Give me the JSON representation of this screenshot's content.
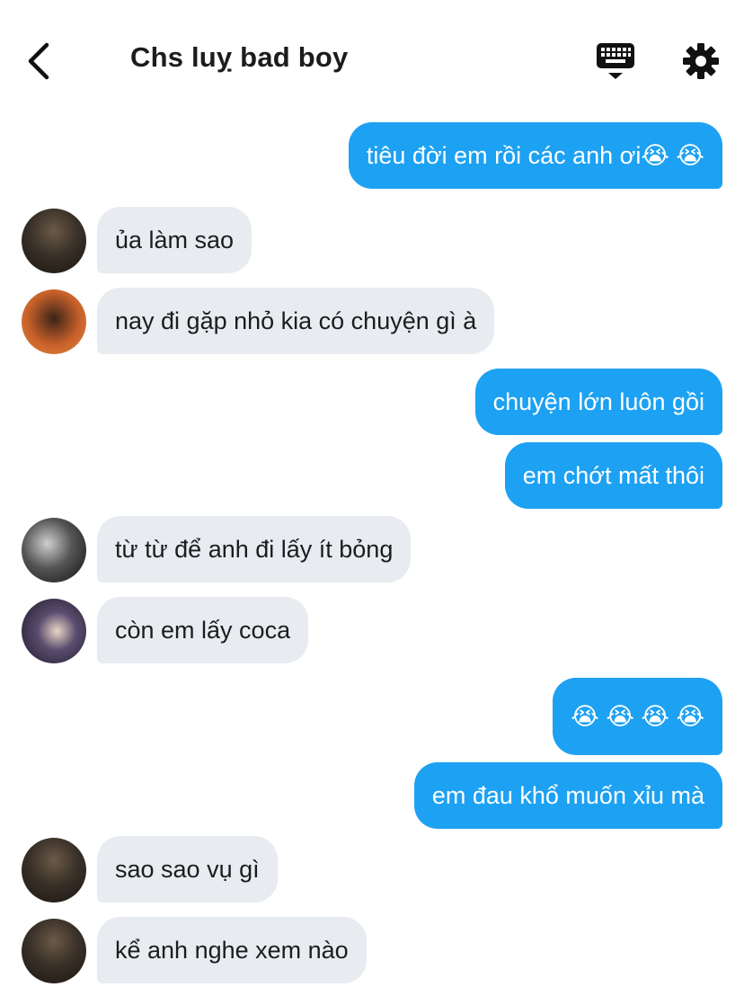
{
  "header": {
    "title": "Chs luỵ bad boy",
    "icons": {
      "back": "chevron-left-icon",
      "keyboard": "keyboard-icon",
      "settings": "gear-icon"
    }
  },
  "colors": {
    "sent_bubble": "#1da1f2",
    "received_bubble": "#e8ecf0",
    "background": "#ffffff"
  },
  "messages": [
    {
      "from": "me",
      "text": "tiêu đời em rồi các anh ơi😭 😭"
    },
    {
      "from": "member",
      "avatar": "avatar-1",
      "text": "ủa làm sao"
    },
    {
      "from": "member",
      "avatar": "avatar-2",
      "text": "nay đi gặp nhỏ kia có chuyện gì à"
    },
    {
      "from": "me",
      "text": "chuyện lớn luôn gồi"
    },
    {
      "from": "me",
      "text": "em chớt mất thôi"
    },
    {
      "from": "member",
      "avatar": "avatar-3",
      "text": "từ từ để anh đi lấy ít bỏng"
    },
    {
      "from": "member",
      "avatar": "avatar-4",
      "text": "còn em lấy coca"
    },
    {
      "from": "me",
      "text": "😭 😭 😭 😭"
    },
    {
      "from": "me",
      "text": "em đau khổ muốn xỉu mà"
    },
    {
      "from": "member",
      "avatar": "avatar-1",
      "text": "sao sao vụ gì"
    },
    {
      "from": "member",
      "avatar": "avatar-1",
      "text": "kể anh nghe xem nào"
    }
  ]
}
